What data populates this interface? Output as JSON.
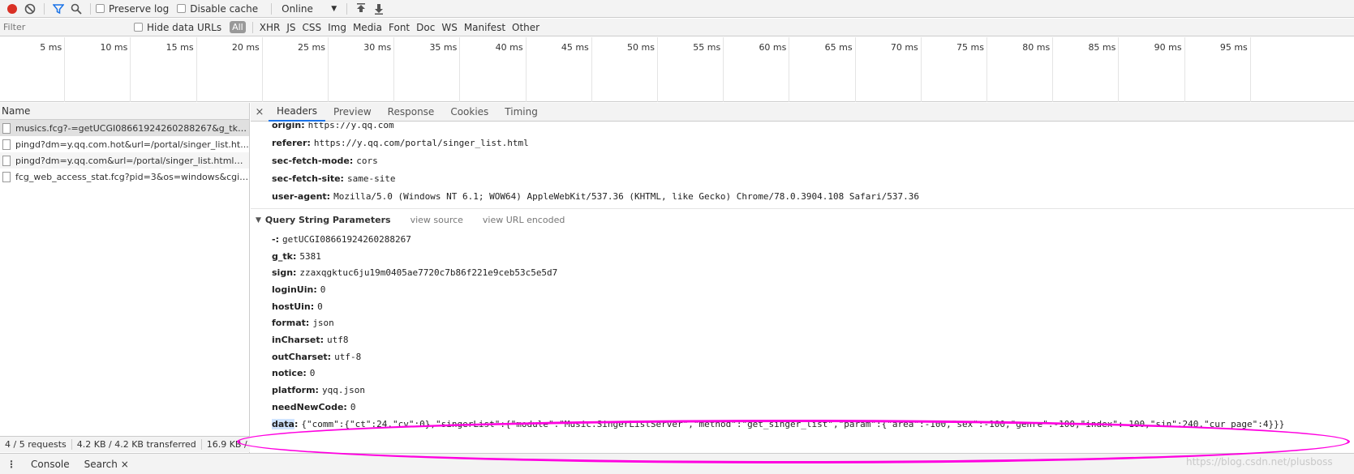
{
  "toolbar": {
    "preserve_log": "Preserve log",
    "disable_cache": "Disable cache",
    "throttle": "Online"
  },
  "filter": {
    "placeholder": "Filter",
    "hide_data_urls": "Hide data URLs",
    "types": [
      "All",
      "XHR",
      "JS",
      "CSS",
      "Img",
      "Media",
      "Font",
      "Doc",
      "WS",
      "Manifest",
      "Other"
    ]
  },
  "timeline": {
    "ticks": [
      "5 ms",
      "10 ms",
      "15 ms",
      "20 ms",
      "25 ms",
      "30 ms",
      "35 ms",
      "40 ms",
      "45 ms",
      "50 ms",
      "55 ms",
      "60 ms",
      "65 ms",
      "70 ms",
      "75 ms",
      "80 ms",
      "85 ms",
      "90 ms",
      "95 ms"
    ]
  },
  "list": {
    "header": "Name",
    "requests": [
      "musics.fcg?-=getUCGI08661924260288267&g_tk=5...",
      "pingd?dm=y.qq.com.hot&url=/portal/singer_list.ht...",
      "pingd?dm=y.qq.com&url=/portal/singer_list.html&r...",
      "fcg_web_access_stat.fcg?pid=3&os=windows&cgi=..."
    ]
  },
  "status": {
    "requests": "4 / 5 requests",
    "transferred": "4.2 KB / 4.2 KB transferred",
    "resources": "16.9 KB /"
  },
  "tabs": [
    "Headers",
    "Preview",
    "Response",
    "Cookies",
    "Timing"
  ],
  "headers": [
    {
      "key": "origin:",
      "value": "https://y.qq.com"
    },
    {
      "key": "referer:",
      "value": "https://y.qq.com/portal/singer_list.html"
    },
    {
      "key": "sec-fetch-mode:",
      "value": "cors"
    },
    {
      "key": "sec-fetch-site:",
      "value": "same-site"
    },
    {
      "key": "user-agent:",
      "value": "Mozilla/5.0 (Windows NT 6.1; WOW64) AppleWebKit/537.36 (KHTML, like Gecko) Chrome/78.0.3904.108 Safari/537.36"
    }
  ],
  "query": {
    "title": "Query String Parameters",
    "view_source": "view source",
    "view_url_encoded": "view URL encoded",
    "params": [
      {
        "key": "-:",
        "value": "getUCGI08661924260288267"
      },
      {
        "key": "g_tk:",
        "value": "5381"
      },
      {
        "key": "sign:",
        "value": "zzaxqgktuc6ju19m0405ae7720c7b86f221e9ceb53c5e5d7"
      },
      {
        "key": "loginUin:",
        "value": "0"
      },
      {
        "key": "hostUin:",
        "value": "0"
      },
      {
        "key": "format:",
        "value": "json"
      },
      {
        "key": "inCharset:",
        "value": "utf8"
      },
      {
        "key": "outCharset:",
        "value": "utf-8"
      },
      {
        "key": "notice:",
        "value": "0"
      },
      {
        "key": "platform:",
        "value": "yqq.json"
      },
      {
        "key": "needNewCode:",
        "value": "0"
      }
    ],
    "data_key": "data",
    "data_value": "{\"comm\":{\"ct\":24,\"cv\":0},\"singerList\":{\"module\":\"Music.SingerListServer\",\"method\":\"get_singer_list\",\"param\":{\"area\":-100,\"sex\":-100,\"genre\":-100,\"index\":-100,\"sin\":240,\"cur_page\":4}}}"
  },
  "drawer": {
    "console": "Console",
    "search": "Search"
  },
  "watermark": "https://blog.csdn.net/plusboss",
  "colors": {
    "record": "#d93025",
    "active_tab": "#1a73e8",
    "annotation": "#ff00e0"
  }
}
